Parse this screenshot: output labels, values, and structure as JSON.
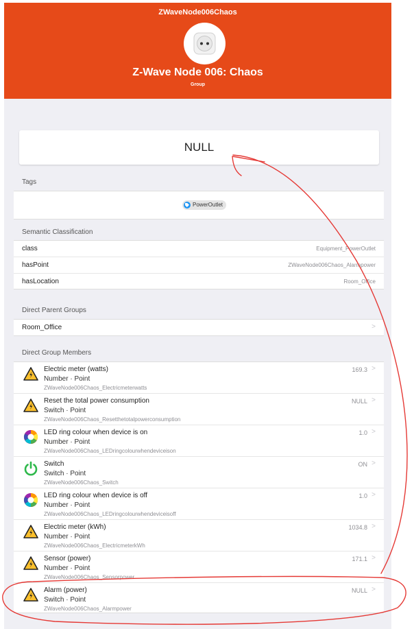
{
  "header": {
    "nav_title": "ZWaveNode006Chaos",
    "title": "Z-Wave Node 006: Chaos",
    "subtitle": "Group",
    "icon": "power-outlet-icon",
    "color": "#e64a19"
  },
  "state": {
    "value": "NULL"
  },
  "tags": {
    "title": "Tags",
    "items": [
      {
        "label": "PowerOutlet",
        "icon": "tag-icon"
      }
    ]
  },
  "semantic": {
    "title": "Semantic Classification",
    "rows": [
      {
        "key": "class",
        "value": "Equipment_PowerOutlet"
      },
      {
        "key": "hasPoint",
        "value": "ZWaveNode006Chaos_Alarmpower"
      },
      {
        "key": "hasLocation",
        "value": "Room_Office"
      }
    ]
  },
  "parents": {
    "title": "Direct Parent Groups",
    "items": [
      {
        "label": "Room_Office"
      }
    ]
  },
  "members": {
    "title": "Direct Group Members",
    "items": [
      {
        "name": "Electric meter (watts)",
        "type": "Number · Point",
        "id": "ZWaveNode006Chaos_Electricmeterwatts",
        "value": "169.3",
        "icon": "warning-icon"
      },
      {
        "name": "Reset the total power consumption",
        "type": "Switch · Point",
        "id": "ZWaveNode006Chaos_Resetthetotalpowerconsumption",
        "value": "NULL",
        "icon": "warning-icon"
      },
      {
        "name": "LED ring colour when device is on",
        "type": "Number · Point",
        "id": "ZWaveNode006Chaos_LEDringcolourwhendeviceison",
        "value": "1.0",
        "icon": "color-wheel-icon"
      },
      {
        "name": "Switch",
        "type": "Switch · Point",
        "id": "ZWaveNode006Chaos_Switch",
        "value": "ON",
        "icon": "power-icon"
      },
      {
        "name": "LED ring colour when device is off",
        "type": "Number · Point",
        "id": "ZWaveNode006Chaos_LEDringcolourwhendeviceisoff",
        "value": "1.0",
        "icon": "color-wheel-icon"
      },
      {
        "name": "Electric meter (kWh)",
        "type": "Number · Point",
        "id": "ZWaveNode006Chaos_ElectricmeterkWh",
        "value": "1034.8",
        "icon": "warning-icon"
      },
      {
        "name": "Sensor (power)",
        "type": "Number · Point",
        "id": "ZWaveNode006Chaos_Sensorpower",
        "value": "171.1",
        "icon": "warning-icon"
      },
      {
        "name": "Alarm (power)",
        "type": "Switch · Point",
        "id": "ZWaveNode006Chaos_Alarmpower",
        "value": "NULL",
        "icon": "warning-icon"
      }
    ]
  },
  "annotation": {
    "color": "#e53935"
  }
}
